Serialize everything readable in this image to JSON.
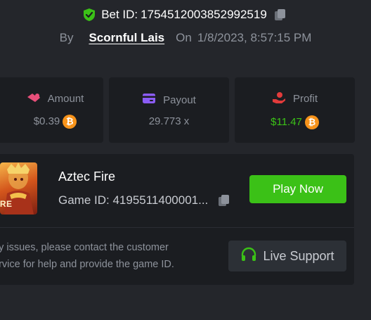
{
  "bet": {
    "label": "Bet ID:",
    "id": "1754512003852992519",
    "by_label": "By",
    "username": "Scornful Lais",
    "on_label": "On",
    "datetime": "1/8/2023, 8:57:15 PM"
  },
  "stats": [
    {
      "label": "Amount",
      "value": "$0.39",
      "icon": "wallet-icon",
      "coin": "bitcoin-icon"
    },
    {
      "label": "Payout",
      "value": "29.773 x",
      "icon": "card-icon"
    },
    {
      "label": "Profit",
      "value": "$11.47",
      "icon": "hand-coin-icon",
      "coin": "bitcoin-icon"
    }
  ],
  "game": {
    "title": "Aztec Fire",
    "id_text": "Game ID: 4195511400001...",
    "play_label": "Play Now",
    "help_line1": "ny issues, please contact the customer",
    "help_line2": "ervice for help and provide the game ID.",
    "support_label": "Live Support",
    "thumb_text": "IRE"
  },
  "colors": {
    "accent_green": "#3bc117",
    "bitcoin": "#f7931a",
    "amount_icon": "#e84f7a",
    "payout_icon": "#8b5cf6",
    "profit_icon": "#e23b3b",
    "card_bg": "#1b1d21",
    "page_bg": "#24262b"
  }
}
